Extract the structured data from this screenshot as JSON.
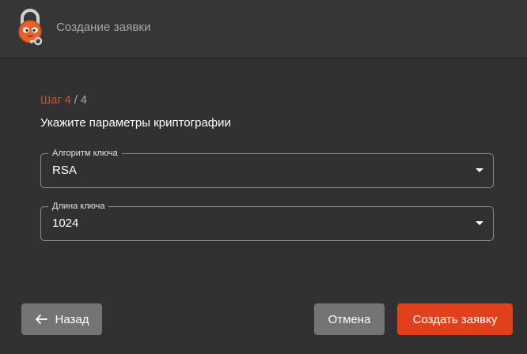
{
  "header": {
    "title": "Создание заявки",
    "logo_icon": "lock-cat-logo-icon"
  },
  "step": {
    "prefix": "Шаг 4",
    "suffix": " / 4",
    "current_color": "#e0462a"
  },
  "form": {
    "heading": "Укажите параметры криптографии",
    "fields": [
      {
        "label": "Алгоритм ключа",
        "value": "RSA"
      },
      {
        "label": "Длина ключа",
        "value": "1024"
      }
    ]
  },
  "buttons": {
    "back_label": "Назад",
    "back_icon": "arrow-left-icon",
    "cancel_label": "Отмена",
    "create_label": "Создать заявку",
    "accent_color": "#e0401c"
  }
}
